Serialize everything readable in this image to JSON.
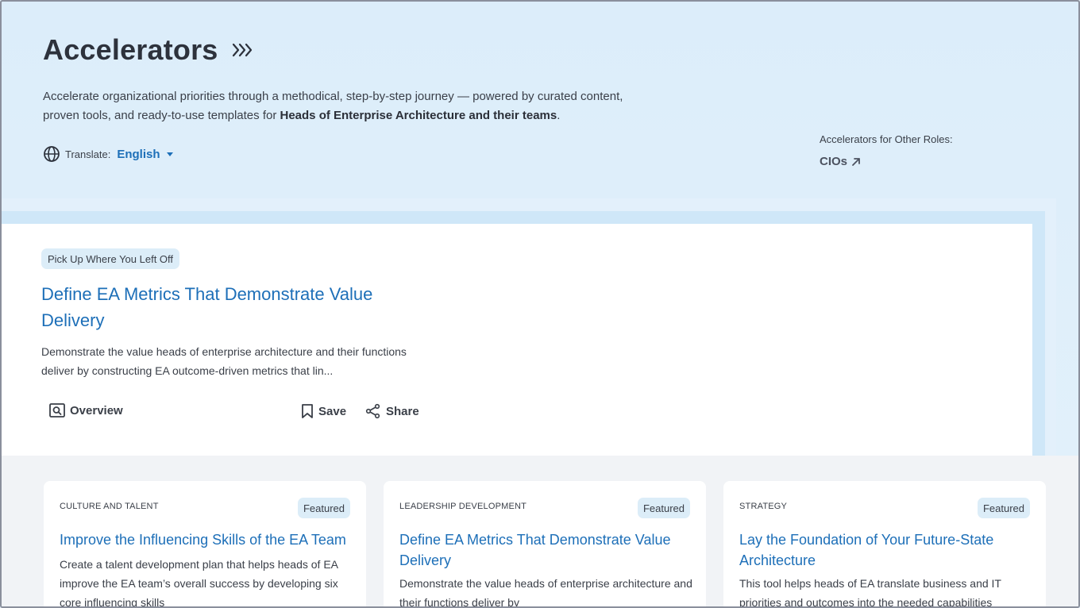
{
  "hero": {
    "title": "Accelerators",
    "description_part1": "Accelerate organizational priorities through a methodical, step-by-step journey — powered by curated content, proven tools, and ready-to-use templates for ",
    "description_bold": "Heads of Enterprise Architecture and their teams",
    "description_end": "."
  },
  "translate": {
    "label": "Translate:",
    "language": "English"
  },
  "other_roles": {
    "label": "Accelerators for Other Roles:",
    "link": "CIOs"
  },
  "resume": {
    "pill": "Pick Up Where You Left Off",
    "title": "Define EA Metrics That Demonstrate Value Delivery",
    "description": "Demonstrate the value heads of enterprise architecture and their functions deliver by constructing EA outcome-driven metrics that lin...",
    "actions": {
      "overview": "Overview",
      "save": "Save",
      "share": "Share"
    }
  },
  "cards": [
    {
      "category": "CULTURE AND TALENT",
      "badge": "Featured",
      "title": "Improve the Influencing Skills of the EA Team",
      "description": "Create a talent development plan that helps heads of EA improve the EA team’s overall success by developing six core influencing skills"
    },
    {
      "category": "LEADERSHIP DEVELOPMENT",
      "badge": "Featured",
      "title": "Define EA Metrics That Demonstrate Value Delivery",
      "description": "Demonstrate the value heads of enterprise architecture and their functions deliver by"
    },
    {
      "category": "STRATEGY",
      "badge": "Featured",
      "title": "Lay the Foundation of Your Future-State Architecture",
      "description": "This tool helps heads of EA translate business and IT priorities and outcomes into the needed capabilities"
    }
  ],
  "colors": {
    "accent": "#1d6fb8",
    "pill_bg": "#dcedf8",
    "hero_bg": "#dcedfa"
  }
}
